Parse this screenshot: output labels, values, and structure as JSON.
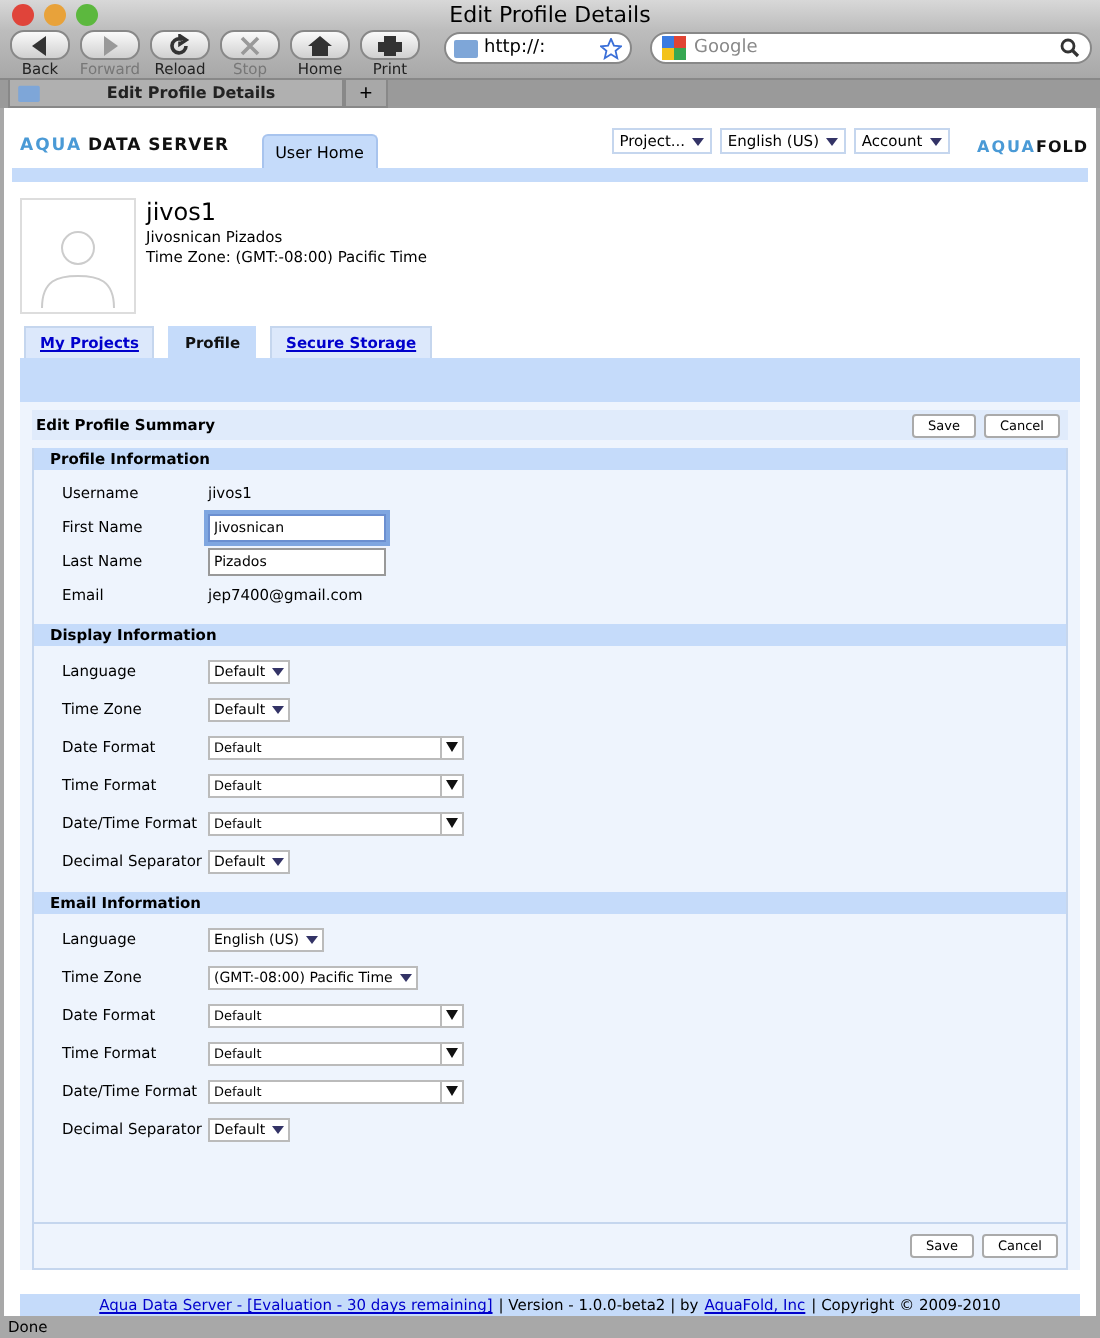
{
  "browser": {
    "title": "Edit Profile Details",
    "toolbar": [
      {
        "label": "Back",
        "disabled": false
      },
      {
        "label": "Forward",
        "disabled": true
      },
      {
        "label": "Reload",
        "disabled": false
      },
      {
        "label": "Stop",
        "disabled": true
      },
      {
        "label": "Home",
        "disabled": false
      },
      {
        "label": "Print",
        "disabled": false
      }
    ],
    "url": "http://:",
    "search_placeholder": "Google",
    "tab_title": "Edit Profile Details",
    "new_tab": "+",
    "status": "Done"
  },
  "app": {
    "logo_left": [
      "AQUA",
      "DATA SERVER"
    ],
    "home_tab": "User Home",
    "menus": [
      "Project...",
      "English (US)",
      "Account"
    ],
    "logo_right": [
      "AQUA",
      "FOLD"
    ]
  },
  "profile": {
    "username": "jivos1",
    "full_name": "Jivosnican Pizados",
    "time_zone": "Time Zone: (GMT:-08:00) Pacific Time"
  },
  "tabs": [
    {
      "label": "My Projects",
      "selected": false
    },
    {
      "label": "Profile",
      "selected": true
    },
    {
      "label": "Secure Storage",
      "selected": false
    }
  ],
  "form": {
    "title": "Edit Profile Summary",
    "buttons": [
      "Save",
      "Cancel"
    ],
    "sections": [
      {
        "title": "Profile Information",
        "rows": [
          {
            "label": "Username",
            "kind": "text",
            "value": "jivos1"
          },
          {
            "label": "First Name",
            "kind": "input",
            "value": "Jivosnican",
            "focused": true
          },
          {
            "label": "Last Name",
            "kind": "input",
            "value": "Pizados",
            "focused": false
          },
          {
            "label": "Email",
            "kind": "text",
            "value": "jep7400@gmail.com"
          }
        ]
      },
      {
        "title": "Display Information",
        "rows": [
          {
            "label": "Language",
            "kind": "select",
            "value": "Default"
          },
          {
            "label": "Time Zone",
            "kind": "select",
            "value": "Default"
          },
          {
            "label": "Date Format",
            "kind": "combo",
            "value": "Default"
          },
          {
            "label": "Time Format",
            "kind": "combo",
            "value": "Default"
          },
          {
            "label": "Date/Time Format",
            "kind": "combo",
            "value": "Default"
          },
          {
            "label": "Decimal Separator",
            "kind": "select",
            "value": "Default"
          }
        ]
      },
      {
        "title": "Email Information",
        "rows": [
          {
            "label": "Language",
            "kind": "select",
            "value": "English (US)"
          },
          {
            "label": "Time Zone",
            "kind": "select",
            "value": "(GMT:-08:00) Pacific Time"
          },
          {
            "label": "Date Format",
            "kind": "combo",
            "value": "Default"
          },
          {
            "label": "Time Format",
            "kind": "combo",
            "value": "Default"
          },
          {
            "label": "Date/Time Format",
            "kind": "combo",
            "value": "Default"
          },
          {
            "label": "Decimal Separator",
            "kind": "select",
            "value": "Default"
          }
        ]
      }
    ],
    "bottom_buttons": [
      "Save",
      "Cancel"
    ]
  },
  "footer": {
    "product_link": "Aqua Data Server - [Evaluation - 30 days remaining]",
    "version": "| Version - 1.0.0-beta2 | by",
    "company_link": "AquaFold, Inc",
    "copyright": "| Copyright © 2009-2010"
  }
}
